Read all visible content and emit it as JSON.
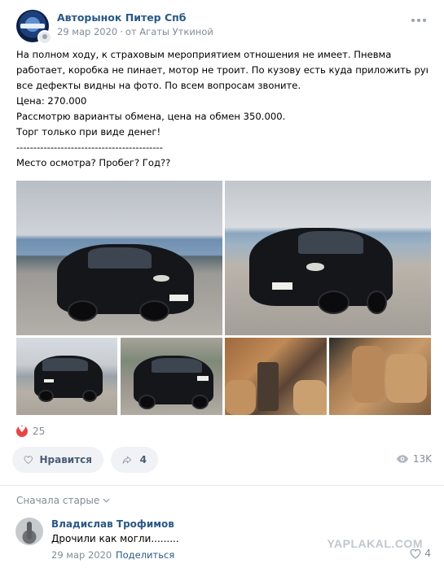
{
  "post": {
    "group_name": "Авторынок Питер Спб",
    "date": "29 мар 2020",
    "separator": "·",
    "from_author": "от Агаты Уткиной",
    "text_lines": [
      "На полном ходу, к страховым мероприятием отношения не имеет. Пневма",
      "работает, коробка не пинает, мотор не троит. По кузову есть куда приложить руки,",
      "все дефекты видны на фото. По всем вопросам звоните.",
      "Цена: 270.000",
      "Рассмотрю варианты обмена, цена на обмен 350.000.",
      "Торг только при виде денег!",
      "-------------------------------------------",
      "Место осмотра? Пробег? Год??"
    ],
    "photo_count": 6
  },
  "reactions": {
    "likes_count": "25",
    "like_label": "Нравится",
    "share_count": "4",
    "views_count": "13K"
  },
  "comments": {
    "sort_label": "Сначала старые",
    "items": [
      {
        "author": "Владислав Трофимов",
        "text": "Дрочили как могли.........",
        "date": "29 мар 2020",
        "reply_label": "Поделиться",
        "likes": "4"
      }
    ]
  },
  "watermark": "YAPLAKAL.COM",
  "icons": {
    "more": "more-dots-icon",
    "like": "heart-outline-icon",
    "share": "share-arrow-icon",
    "views": "eye-icon",
    "sort": "chevron-down-icon"
  },
  "colors": {
    "link": "#2a5885",
    "secondary_text": "#818c99",
    "button_bg": "#f0f2f5",
    "like_red": "#e64646"
  }
}
